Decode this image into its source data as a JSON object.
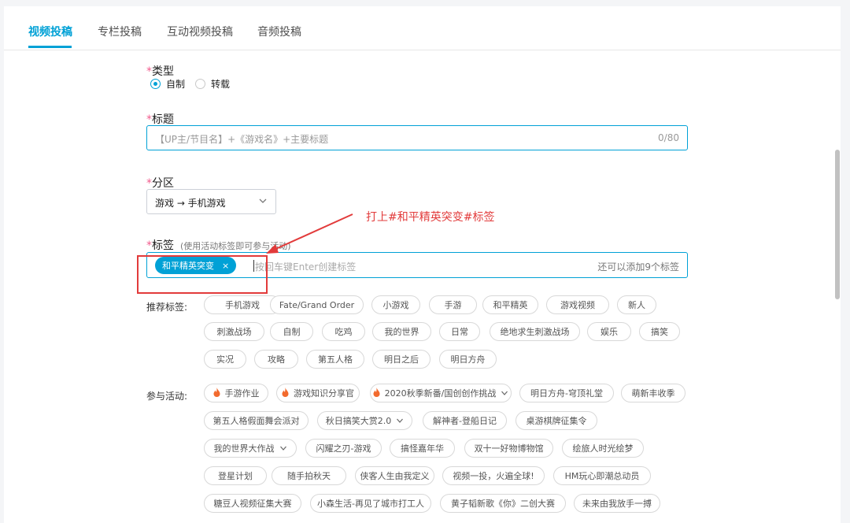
{
  "tabs": [
    {
      "label": "视频投稿",
      "active": true
    },
    {
      "label": "专栏投稿",
      "active": false
    },
    {
      "label": "互动视频投稿",
      "active": false
    },
    {
      "label": "音频投稿",
      "active": false
    }
  ],
  "required_mark": "*",
  "type_section": {
    "label": "类型",
    "options": [
      {
        "label": "自制",
        "checked": true
      },
      {
        "label": "转载",
        "checked": false
      }
    ]
  },
  "title_section": {
    "label": "标题",
    "placeholder": "【UP主/节目名】+《游戏名》+主要标题",
    "counter": "0/80"
  },
  "zone_section": {
    "label": "分区",
    "selected": "游戏 → 手机游戏"
  },
  "tag_section": {
    "label": "标签",
    "hint": "(使用活动标签即可参与活动)",
    "chip": "和平精英突变",
    "chip_close": "×",
    "placeholder": "按回车键Enter创建标签",
    "remaining": "还可以添加9个标签"
  },
  "recommended": {
    "label": "推荐标签:",
    "tags": [
      "手机游戏",
      "Fate/Grand Order",
      "小游戏",
      "手游",
      "和平精英",
      "游戏视频",
      "新人",
      "刺激战场",
      "自制",
      "吃鸡",
      "我的世界",
      "日常",
      "绝地求生刺激战场",
      "娱乐",
      "搞笑",
      "实况",
      "攻略",
      "第五人格",
      "明日之后",
      "明日方舟"
    ]
  },
  "activities": {
    "label": "参与活动:",
    "items": [
      "手游作业",
      "游戏知识分享官",
      "2020秋季新番/国创创作挑战",
      "明日方舟-穹顶礼堂",
      "萌新丰收季",
      "第五人格假面舞会派对",
      "秋日搞笑大赏2.0",
      "解神者-登船日记",
      "桌游棋牌征集令",
      "我的世界大作战",
      "闪耀之刃-游戏",
      "搞怪嘉年华",
      "双十一好物博物馆",
      "绘旅人时光绘梦",
      "登星计划",
      "随手拍秋天",
      "侠客人生由我定义",
      "视频一投，火遍全球!",
      "HM玩心即潮总动员",
      "糖豆人视频征集大赛",
      "小森生活-再见了城市打工人",
      "黄子韬新歌《你》二创大赛",
      "未来由我放手一搏"
    ]
  },
  "annotation": {
    "text": "打上#和平精英突变#标签"
  },
  "colors": {
    "accent": "#00a1d6",
    "required": "#f25d8e",
    "annotation": "#e23b3b",
    "fire": "#f26a2e"
  },
  "icons": {
    "dropdown": "chevron-down-icon",
    "fire": "fire-icon",
    "close": "close-icon"
  }
}
